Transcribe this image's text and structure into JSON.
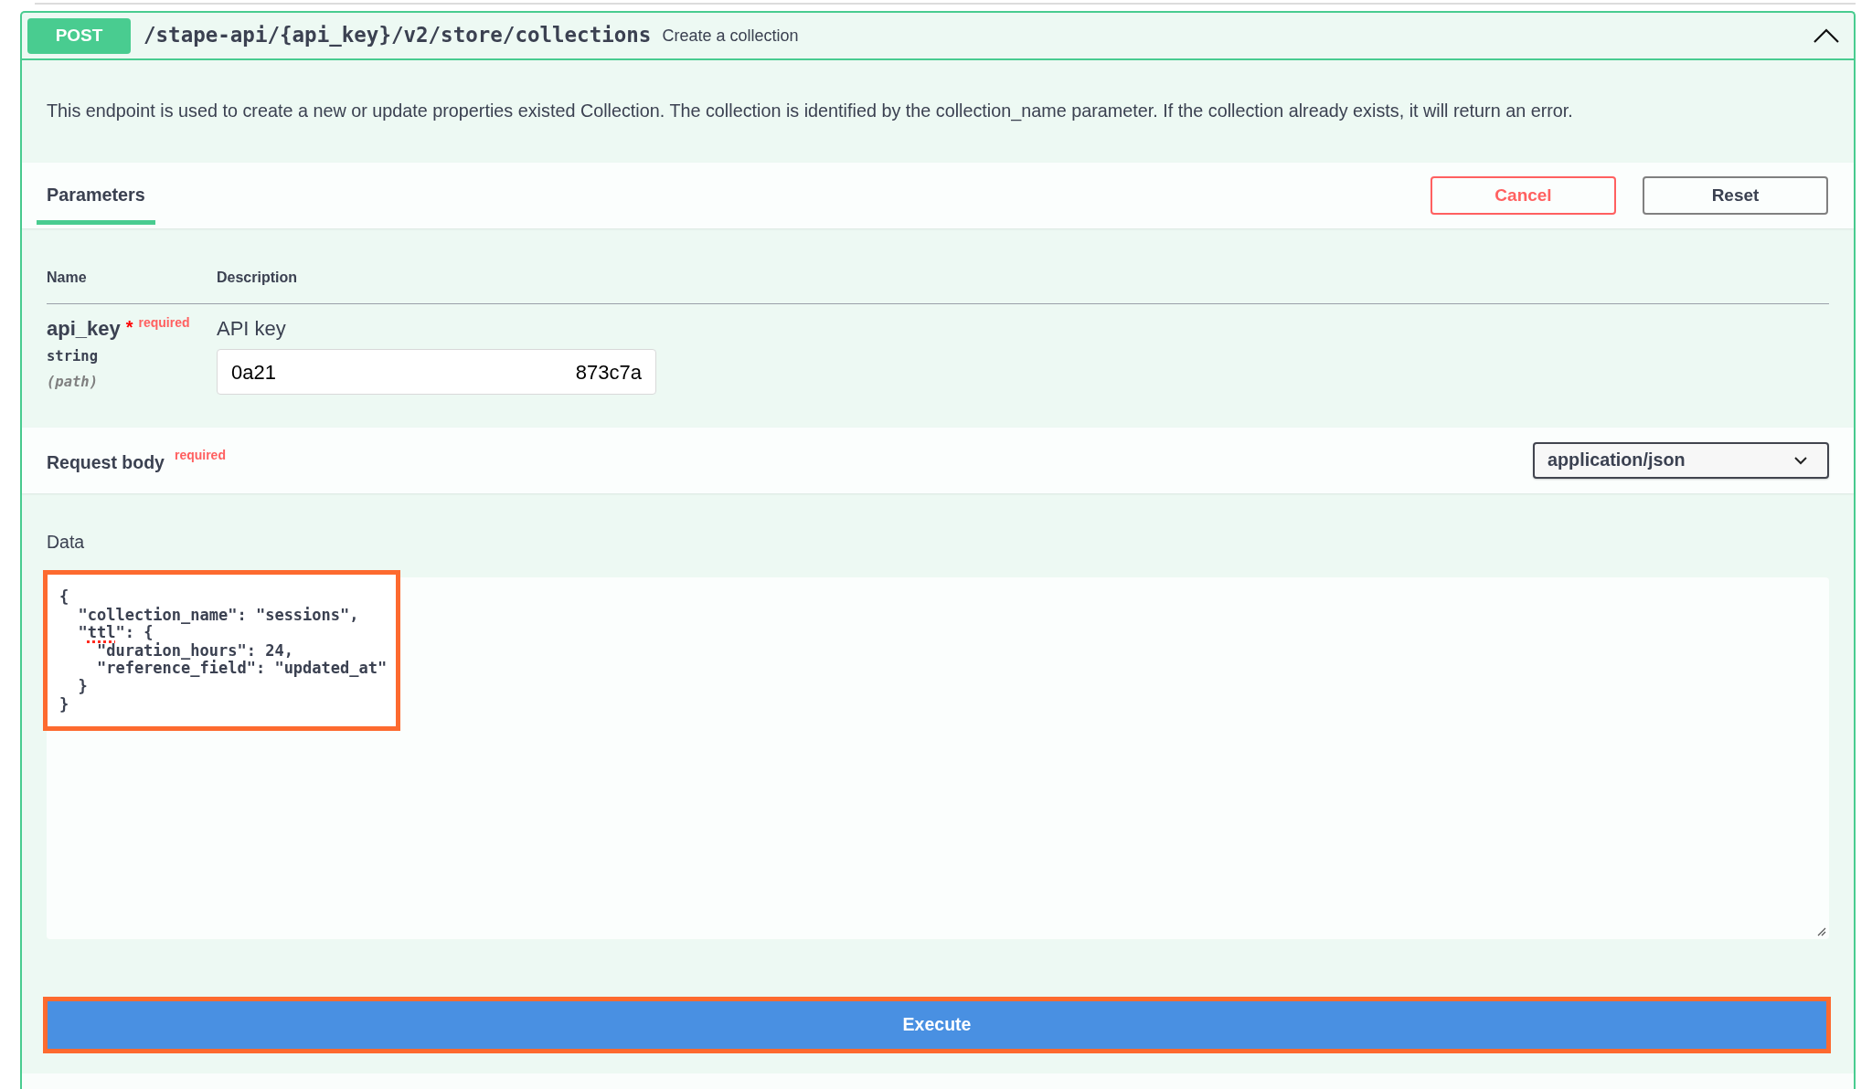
{
  "operation": {
    "method": "POST",
    "path": "/stape-api/{api_key}/v2/store/collections",
    "summary": "Create a collection",
    "expanded": true,
    "description": "This endpoint is used to create a new or update properties existed Collection. The collection is identified by the collection_name parameter. If the collection already exists, it will return an error."
  },
  "tabs": [
    {
      "label": "Parameters",
      "selected": true
    }
  ],
  "buttons": [
    {
      "label": "Cancel",
      "kind": "cancel"
    },
    {
      "label": "Reset",
      "kind": "reset"
    }
  ],
  "parameters": {
    "columns": [
      "Name",
      "Description"
    ],
    "rows": [
      {
        "name": "api_key",
        "required_mark": "*",
        "required_label": "required",
        "type": "string",
        "location": "(path)",
        "description": "API key",
        "value_parts": [
          "0a21",
          "873c7a"
        ]
      }
    ]
  },
  "request_body": {
    "title": "Request body",
    "required_label": "required",
    "content_type": "application/json",
    "label": "Data",
    "highlighted": true,
    "code_lines": [
      {
        "segments": [
          {
            "text": "{",
            "misspelled": false
          }
        ]
      },
      {
        "segments": [
          {
            "text": "  \"collection_name\": \"sessions\",",
            "misspelled": false
          }
        ]
      },
      {
        "segments": [
          {
            "text": "  \"",
            "misspelled": false
          },
          {
            "text": "ttl",
            "misspelled": true
          },
          {
            "text": "\": {",
            "misspelled": false
          }
        ]
      },
      {
        "segments": [
          {
            "text": "    \"duration_hours\": 24,",
            "misspelled": false
          }
        ]
      },
      {
        "segments": [
          {
            "text": "    \"reference_field\": \"updated_at\"",
            "misspelled": false
          }
        ]
      },
      {
        "segments": [
          {
            "text": "  }",
            "misspelled": false
          }
        ]
      },
      {
        "segments": [
          {
            "text": "}",
            "misspelled": false
          }
        ]
      }
    ]
  },
  "execute": {
    "label": "Execute",
    "highlighted": true
  }
}
